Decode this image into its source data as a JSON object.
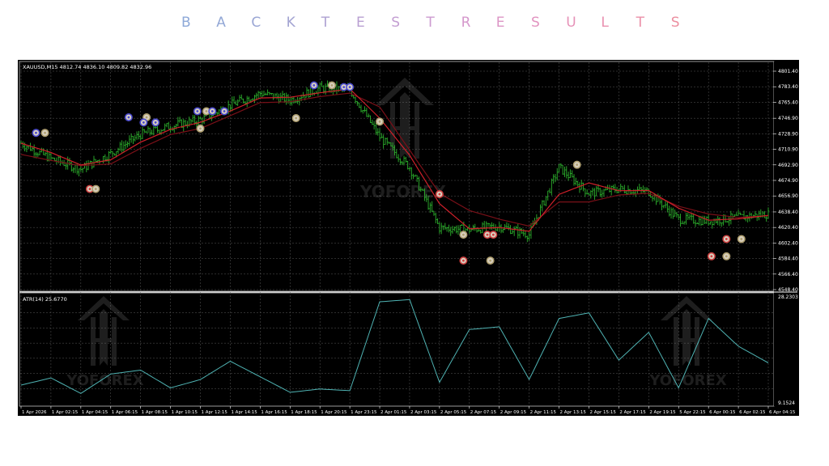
{
  "page": {
    "title_letters": [
      "B",
      "A",
      "C",
      "K",
      "T",
      "E",
      "S",
      "T",
      "R",
      "E",
      "S",
      "U",
      "L",
      "T",
      "S"
    ],
    "title_colors": [
      "#8ea9d8",
      "#93a8d6",
      "#9aa6d4",
      "#a3a4d2",
      "#aea2d2",
      "#b9a0d2",
      "#c39ed2",
      "#cd9bd0",
      "#d598cc",
      "#dc96c6",
      "#e294c0",
      "#e692b8",
      "#e991b0",
      "#eb90a8",
      "#ec8fa0"
    ]
  },
  "main_chart": {
    "symbol_info": "XAUUSD,M15  4812.74 4836.10 4809.82 4832.96",
    "price_labels": [
      "4801.40",
      "4783.40",
      "4765.40",
      "4746.90",
      "4728.90",
      "4710.90",
      "4692.90",
      "4674.90",
      "4656.90",
      "4638.40",
      "4620.40",
      "4602.40",
      "4584.40",
      "4566.40",
      "4548.40"
    ],
    "y_range": [
      4548.4,
      4801.4
    ],
    "watermark_text": "YOFOREX"
  },
  "atr_panel": {
    "label": "ATR(14) 25.6770",
    "top_value": "28.2303",
    "bottom_value": "9.1524",
    "watermark_text_1": "YOFOREX",
    "watermark_text_2": "YOFOREX"
  },
  "time_labels": [
    "1 Apr 2026",
    "1 Apr 02:15",
    "1 Apr 04:15",
    "1 Apr 06:15",
    "1 Apr 08:15",
    "1 Apr 10:15",
    "1 Apr 12:15",
    "1 Apr 14:15",
    "1 Apr 16:15",
    "1 Apr 18:15",
    "1 Apr 20:15",
    "1 Apr 23:15",
    "2 Apr 01:15",
    "2 Apr 03:15",
    "2 Apr 05:15",
    "2 Apr 07:15",
    "2 Apr 09:15",
    "2 Apr 11:15",
    "2 Apr 13:15",
    "2 Apr 15:15",
    "2 Apr 17:15",
    "2 Apr 19:15",
    "5 Apr 22:15",
    "6 Apr 00:15",
    "6 Apr 02:15",
    "6 Apr 04:15"
  ],
  "colors": {
    "background": "#000000",
    "candles": "#2db22d",
    "fast_ma": "#d0202a",
    "slow_ma": "#7a1018",
    "atr_line": "#4fb3b3",
    "grid": "#5a5a5a",
    "marker_buy": "#4a4ad0",
    "marker_sell": "#d04040",
    "marker_close": "#b0a070"
  },
  "chart_data": {
    "type": "line",
    "x": [
      "1 Apr 2026",
      "1 Apr 02:15",
      "1 Apr 04:15",
      "1 Apr 06:15",
      "1 Apr 08:15",
      "1 Apr 10:15",
      "1 Apr 12:15",
      "1 Apr 14:15",
      "1 Apr 16:15",
      "1 Apr 18:15",
      "1 Apr 20:15",
      "1 Apr 23:15",
      "2 Apr 01:15",
      "2 Apr 03:15",
      "2 Apr 05:15",
      "2 Apr 07:15",
      "2 Apr 09:15",
      "2 Apr 11:15",
      "2 Apr 13:15",
      "2 Apr 15:15",
      "2 Apr 17:15",
      "2 Apr 19:15",
      "5 Apr 22:15",
      "6 Apr 00:15",
      "6 Apr 02:15",
      "6 Apr 04:15"
    ],
    "series": [
      {
        "values": [
          4718,
          4700,
          4688,
          4706,
          4728,
          4738,
          4745,
          4762,
          4776,
          4768,
          4782,
          4780,
          4725,
          4690,
          4620,
          4618,
          4622,
          4612,
          4690,
          4660,
          4665,
          4662,
          4630,
          4628,
          4632,
          4636
        ]
      },
      {
        "values": [
          4705,
          4698,
          4692,
          4694,
          4712,
          4728,
          4735,
          4750,
          4765,
          4766,
          4772,
          4776,
          4760,
          4710,
          4660,
          4640,
          4630,
          4622,
          4650,
          4650,
          4658,
          4660,
          4645,
          4636,
          4632,
          4634
        ]
      },
      {
        "values": [
          12.5,
          13.8,
          11.0,
          14.5,
          15.2,
          12.0,
          13.5,
          16.8,
          14.0,
          11.2,
          11.8,
          11.5,
          27.5,
          27.9,
          13.0,
          22.5,
          23.0,
          13.5,
          24.5,
          25.5,
          17.0,
          22.0,
          12.0,
          24.5,
          19.5,
          16.5
        ]
      }
    ],
    "ylim": [
      4548.4,
      4801.4
    ],
    "atr_ylim": [
      9.1524,
      28.2303
    ],
    "grid": true,
    "markers": [
      {
        "x": 0.5,
        "price": 4730,
        "kind": "buy"
      },
      {
        "x": 0.8,
        "price": 4730,
        "kind": "close"
      },
      {
        "x": 2.3,
        "price": 4665,
        "kind": "sell"
      },
      {
        "x": 2.5,
        "price": 4665,
        "kind": "close"
      },
      {
        "x": 3.6,
        "price": 4748,
        "kind": "buy"
      },
      {
        "x": 4.2,
        "price": 4748,
        "kind": "close"
      },
      {
        "x": 4.1,
        "price": 4742,
        "kind": "buy"
      },
      {
        "x": 4.5,
        "price": 4742,
        "kind": "buy"
      },
      {
        "x": 5.9,
        "price": 4755,
        "kind": "buy"
      },
      {
        "x": 6.2,
        "price": 4755,
        "kind": "close"
      },
      {
        "x": 6.4,
        "price": 4755,
        "kind": "buy"
      },
      {
        "x": 6.8,
        "price": 4755,
        "kind": "buy"
      },
      {
        "x": 6.0,
        "price": 4735,
        "kind": "close"
      },
      {
        "x": 9.2,
        "price": 4747,
        "kind": "close"
      },
      {
        "x": 9.8,
        "price": 4785,
        "kind": "buy"
      },
      {
        "x": 10.4,
        "price": 4785,
        "kind": "close"
      },
      {
        "x": 10.8,
        "price": 4783,
        "kind": "buy"
      },
      {
        "x": 11.0,
        "price": 4783,
        "kind": "buy"
      },
      {
        "x": 12.0,
        "price": 4743,
        "kind": "close"
      },
      {
        "x": 14.0,
        "price": 4659,
        "kind": "sell"
      },
      {
        "x": 14.8,
        "price": 4612,
        "kind": "close"
      },
      {
        "x": 15.6,
        "price": 4612,
        "kind": "sell"
      },
      {
        "x": 15.8,
        "price": 4612,
        "kind": "sell"
      },
      {
        "x": 14.8,
        "price": 4582,
        "kind": "sell"
      },
      {
        "x": 15.7,
        "price": 4582,
        "kind": "close"
      },
      {
        "x": 18.6,
        "price": 4693,
        "kind": "close"
      },
      {
        "x": 23.6,
        "price": 4607,
        "kind": "sell"
      },
      {
        "x": 24.1,
        "price": 4607,
        "kind": "close"
      },
      {
        "x": 23.1,
        "price": 4587,
        "kind": "sell"
      },
      {
        "x": 23.6,
        "price": 4587,
        "kind": "close"
      }
    ]
  }
}
